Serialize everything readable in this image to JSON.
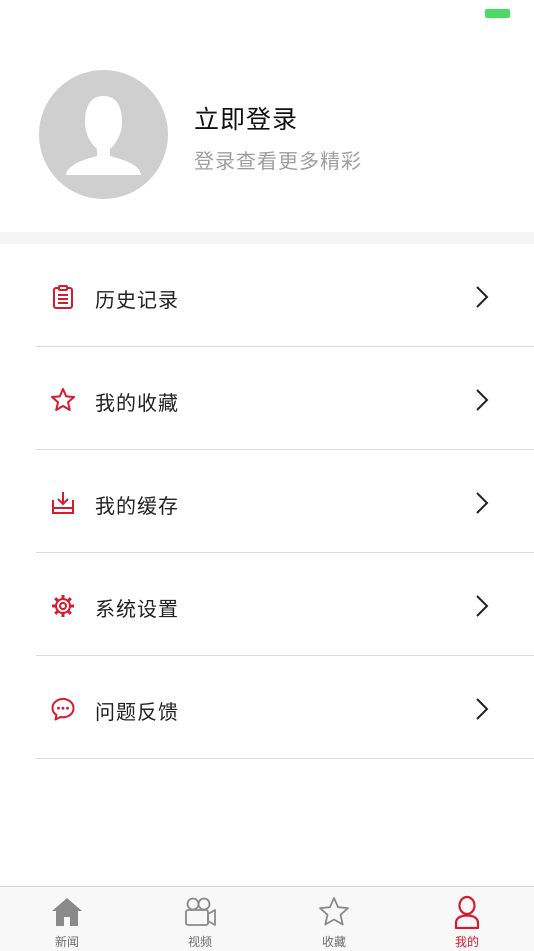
{
  "colors": {
    "accent": "#d9192c",
    "battery": "#4cd964",
    "avatar_bg": "#cfcfcf"
  },
  "profile": {
    "title": "立即登录",
    "subtitle": "登录查看更多精彩"
  },
  "menu": {
    "items": [
      {
        "label": "历史记录",
        "icon": "clipboard-icon"
      },
      {
        "label": "我的收藏",
        "icon": "star-icon"
      },
      {
        "label": "我的缓存",
        "icon": "download-tray-icon"
      },
      {
        "label": "系统设置",
        "icon": "gear-icon"
      },
      {
        "label": "问题反馈",
        "icon": "chat-bubble-icon"
      }
    ]
  },
  "tabbar": {
    "tabs": [
      {
        "label": "新闻",
        "icon": "home-icon"
      },
      {
        "label": "视频",
        "icon": "video-camera-icon"
      },
      {
        "label": "收藏",
        "icon": "star-icon"
      },
      {
        "label": "我的",
        "icon": "person-icon",
        "active": true
      }
    ]
  }
}
